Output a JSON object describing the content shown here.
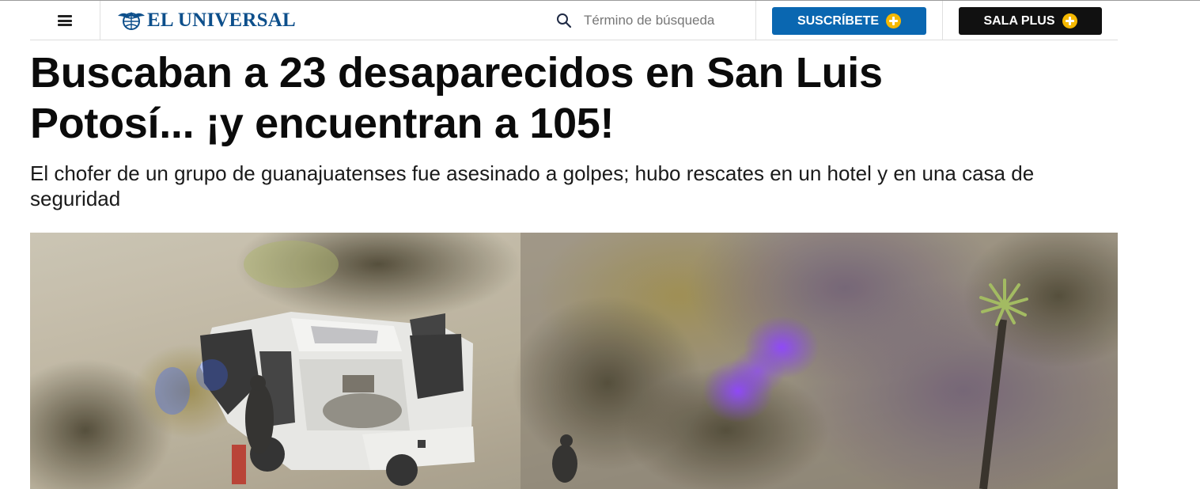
{
  "header": {
    "menu_icon": "hamburger-menu-icon",
    "logo": {
      "text": "EL UNIVERSAL",
      "emblem_icon": "eagle-globe-icon",
      "color": "#0d4f8b"
    },
    "search": {
      "icon": "search-icon",
      "placeholder": "Término de búsqueda",
      "value": ""
    },
    "subscribe_button": {
      "label": "SUSCRÍBETE",
      "icon": "plus-circle-icon",
      "background": "#0a67b1",
      "icon_color": "#f5b800"
    },
    "sala_plus_button": {
      "label": "SALA PLUS",
      "icon": "plus-circle-icon",
      "background": "#111111",
      "icon_color": "#f5b800"
    }
  },
  "article": {
    "headline": "Buscaban a 23 desaparecidos en San Luis Potosí... ¡y encuentran a 105!",
    "subheadline": "El chofer de un grupo de guanajuatenses fue asesinado a golpes; hubo rescates en un hotel y en una casa de seguridad",
    "hero_image": {
      "icon": "news-photo",
      "scene": "aerial view of a white pickup truck on a dirt road among desert shrubs, with violet smoke"
    }
  }
}
